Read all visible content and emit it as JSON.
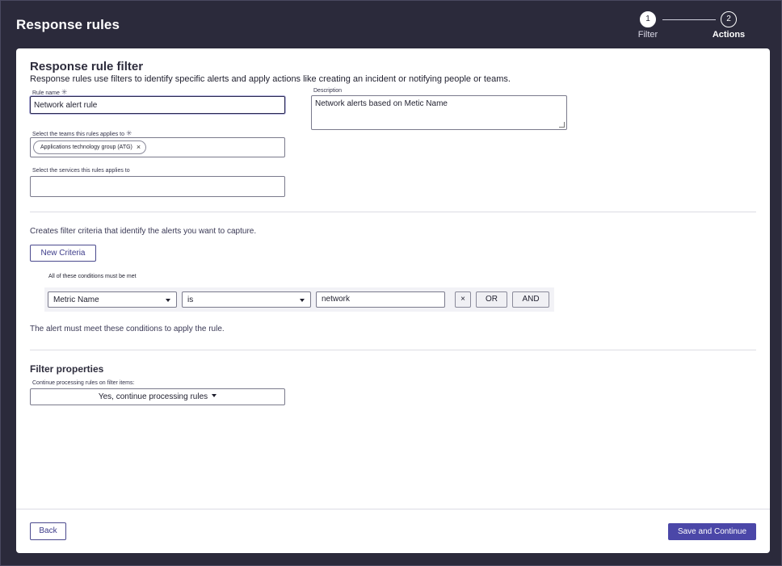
{
  "header": {
    "title": "Response rules"
  },
  "stepper": {
    "steps": [
      {
        "number": "1",
        "label": "Filter"
      },
      {
        "number": "2",
        "label": "Actions"
      }
    ]
  },
  "filter": {
    "title": "Response rule filter",
    "description": "Response rules use filters to identify specific alerts and apply actions like creating an incident or notifying people or teams.",
    "rule_name_label": "Rule name",
    "rule_name_value": "Network alert rule",
    "required_mark": "✳",
    "description_label": "Description",
    "description_value": "Network alerts based on Metic Name",
    "teams_label": "Select the teams this rules applies to",
    "teams_chip": "Applications technology group (ATG)",
    "chip_remove": "×",
    "services_label": "Select the services this rules applies to",
    "services_value": ""
  },
  "criteria": {
    "intro": "Creates filter criteria that identify the alerts you want to capture.",
    "new_button": "New Criteria",
    "conditions_label": "All of these conditions must be met",
    "field_value": "Metric Name",
    "operator_value": "is",
    "match_value": "network",
    "remove_label": "×",
    "or_label": "OR",
    "and_label": "AND",
    "help": "The alert must meet these conditions to apply the rule."
  },
  "properties": {
    "title": "Filter properties",
    "continue_label": "Continue processing rules on filter items:",
    "continue_value": "Yes, continue processing rules"
  },
  "footer": {
    "back_label": "Back",
    "save_label": "Save and Continue"
  },
  "colors": {
    "background": "#2b2a3b",
    "accent": "#4b47a8"
  }
}
